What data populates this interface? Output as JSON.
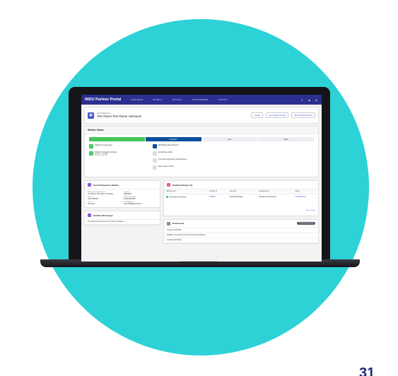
{
  "page_number": "31",
  "colors": {
    "background_circle": "#2dd2d6",
    "nav": "#2b2f8f",
    "accent": "#3b55c8"
  },
  "app": {
    "brand": "INDU Partner Portal",
    "nav": [
      "STARTSEITE",
      "MATERIAL",
      "ANFRAGE",
      "VERTRIEBSWEGE",
      "SUPPORT"
    ],
    "icons": [
      "search-icon",
      "bell-icon",
      "user-icon"
    ]
  },
  "record": {
    "type": "Geschäftspartner",
    "title": "Test Owner Test Owner vorbname",
    "buttons": [
      "+ Folgen",
      "Neue Support-Anfrage",
      "Neuen Bankenschlüssel"
    ]
  },
  "status": {
    "title": "Händler Status",
    "steps": [
      {
        "label": "✓",
        "state": "done"
      },
      {
        "label": "Registriert",
        "state": "current"
      },
      {
        "label": "Aktiv",
        "state": "todo"
      },
      {
        "label": "Inaktiv",
        "state": "todo"
      }
    ],
    "tasks_left": [
      {
        "text": "Händler ist angemeldet",
        "sub": "",
        "state": "done"
      },
      {
        "text": "Händler hat Angebot erhalten",
        "sub": "Angebot: 1 erstellt",
        "date": "Datum: 24.09.2021",
        "state": "done"
      }
    ],
    "tasks_right": [
      {
        "text": "Prüfauftrag abgeschlossen",
        "state": "current"
      },
      {
        "text": "Erstanfrage erfolgt",
        "state": "todo"
      },
      {
        "text": "Unternehmensprüfung abgeschlossen",
        "state": "todo"
      },
      {
        "text": "Rechnungen eröffnet",
        "state": "todo"
      }
    ]
  },
  "details": {
    "title": "Geschäftspartner-Details",
    "fields": [
      {
        "label": "Name des Partnerbetriebs",
        "value": "Test Owner Test Owner vorbname"
      },
      {
        "label": "Zentrale",
        "value": "NEOSOFT"
      },
      {
        "label": "Telefon",
        "value": "76277316036"
      },
      {
        "label": "Datum der Anfrage",
        "value": "23.09.2021 PM"
      },
      {
        "label": "Land",
        "value": "Germany"
      },
      {
        "label": "E-Mail-Adresse",
        "value": "test.email@example.de"
      }
    ]
  },
  "requests": {
    "title": "Händleranfragen (1)",
    "columns": [
      "Händlername",
      "Anfrage ID",
      "Kategorie",
      "Auswahlmenü",
      "Status"
    ],
    "rows": [
      [
        "Test Owner Test Owner...",
        "CASE01",
        "Generelle Anfrage",
        "Mit eigener Abrechnung",
        "In Bearbeitung"
      ]
    ],
    "view_all": "Alle anzeigen"
  },
  "notes": {
    "title": "Händler-Messenger",
    "line": "Test Owner hat Test Owner Test Owner vorbname..."
  },
  "documents": {
    "title": "Dokumente",
    "badge": "Prüfung ausstehend",
    "lines": [
      "Angebot 24.09.2021",
      "Angaben zum Kunden (bei Unternehmensverbänden)",
      "Gewerbeanmeldung"
    ]
  }
}
